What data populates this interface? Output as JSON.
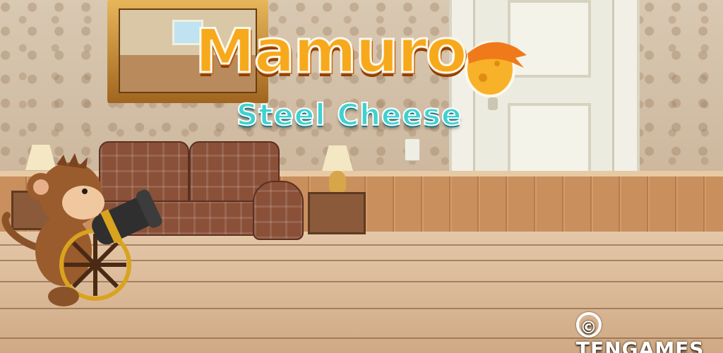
{
  "game": {
    "title": "Mamuro",
    "subtitle": "Steel Cheese"
  },
  "copyright": {
    "symbol": "©",
    "label": "TENGAMES"
  },
  "colors": {
    "title_orange": "#f7a91c",
    "subtitle_cyan": "#3fd1d0",
    "bandana_orange": "#f07a1a",
    "wall": "#d3bfa5",
    "floor": "#dcb996"
  },
  "characters": [
    {
      "name": "monkey",
      "holding": "cannon"
    }
  ]
}
